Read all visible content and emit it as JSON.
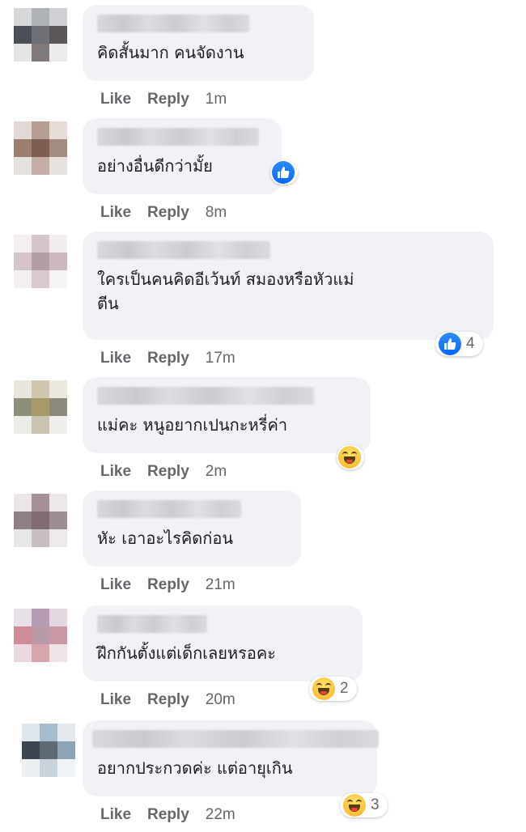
{
  "actions": {
    "like": "Like",
    "reply": "Reply"
  },
  "comments": [
    {
      "text": "คิดสั้นมาก คนจัดงาน",
      "time": "1m"
    },
    {
      "text": "อย่างอื่นดีกว่ามั้ย",
      "time": "8m",
      "reaction": "like-icon"
    },
    {
      "text": "ใครเป็นคนคิดอีเว้นท์ สมองหรือหัวแม่\nตีน",
      "time": "17m",
      "reaction": "like-icon",
      "reaction_count": "4"
    },
    {
      "text": "แม่คะ หนูอยากเปนกะหรี่ค่า",
      "time": "2m",
      "reaction": "haha-icon"
    },
    {
      "text": "หัะ เอาอะไรคิดก่อน",
      "time": "21m"
    },
    {
      "text": "ฝึกกันตั้งแต่เด็กเลยหรอคะ",
      "time": "20m",
      "reaction": "haha-icon",
      "reaction_count": "2"
    },
    {
      "text": "อยากประกวดค่ะ แต่อายุเกิน",
      "time": "22m",
      "reaction": "haha-icon",
      "reaction_count": "3"
    }
  ],
  "colors": {
    "bubble": "#f0f2f5",
    "action_text": "#65676b",
    "like_blue": "#0866ff",
    "haha_yellow": "#f7b125"
  }
}
